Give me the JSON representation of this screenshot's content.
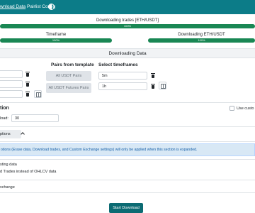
{
  "nav": {
    "items": [
      "wnload Data",
      "Pairlist Config"
    ],
    "theme_icon": "half-circle-icon"
  },
  "progress": {
    "main": {
      "label": "Downloading trades [ETH/USDT]",
      "value_text": "100%",
      "value": 100
    },
    "timeframe": {
      "label": "Timeframe",
      "value_text": "100%",
      "value": 100
    },
    "pair": {
      "label": "Downloading ETH/USDT",
      "value_text": "100%",
      "value": 100
    }
  },
  "section": {
    "title": "Downloading Data"
  },
  "pairs": {
    "inputs": [
      "",
      "",
      ""
    ],
    "template_heading": "Pairs from template",
    "template_buttons": [
      "All USDT Pairs",
      "All USDT Futures Pairs"
    ]
  },
  "timeframes": {
    "heading": "Select timeframes",
    "values": [
      "5m",
      "1h"
    ]
  },
  "options": {
    "heading": "tion",
    "custom_label": "Use custo",
    "days_label": "load:",
    "days_value": "30"
  },
  "advanced": {
    "toggle_label": "ptions",
    "info_text": "otions (Erase data, Download trades, and Custom Exchange settings) will only be applied when this section is expanded.",
    "option1": "sting data",
    "option2": "d Trades instead of OHLCV data",
    "option3": "xchange"
  },
  "actions": {
    "start_label": "Start Download"
  },
  "colors": {
    "primary": "#0c7c88",
    "progress": "#198754",
    "info_bg": "#d8e8f5"
  }
}
